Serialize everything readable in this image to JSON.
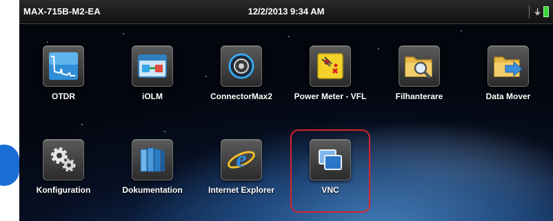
{
  "status_bar": {
    "device_name": "MAX-715B-M2-EA",
    "datetime": "12/2/2013 9:34 AM",
    "power_icon": "plug-icon",
    "battery_icon": "battery-icon"
  },
  "apps": [
    {
      "label": "OTDR",
      "icon": "otdr-trace-icon"
    },
    {
      "label": "iOLM",
      "icon": "iolm-icon"
    },
    {
      "label": "ConnectorMax2",
      "icon": "connector-icon"
    },
    {
      "label": "Power Meter - VFL",
      "icon": "power-meter-icon"
    },
    {
      "label": "Filhanterare",
      "icon": "file-manager-icon"
    },
    {
      "label": "Data Mover",
      "icon": "data-mover-icon"
    },
    {
      "label": "Konfiguration",
      "icon": "gears-icon"
    },
    {
      "label": "Dokumentation",
      "icon": "books-icon"
    },
    {
      "label": "Internet Explorer",
      "icon": "internet-explorer-icon"
    },
    {
      "label": "VNC",
      "icon": "vnc-icon"
    }
  ],
  "colors": {
    "highlight": "#d8232a",
    "step_badge": "#1a6fd6",
    "battery": "#3ed23e"
  }
}
